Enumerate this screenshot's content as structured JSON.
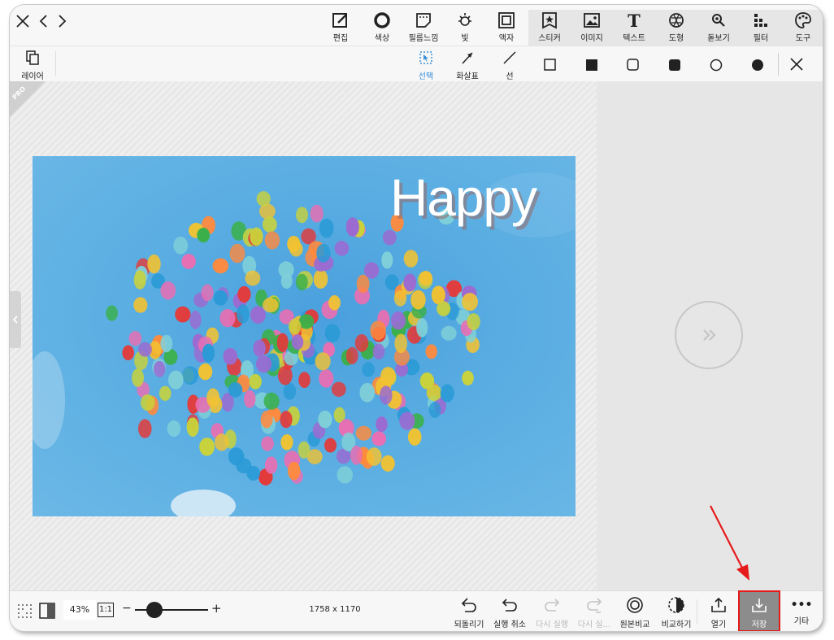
{
  "top_tools": [
    {
      "label": "편집",
      "icon": "edit-icon"
    },
    {
      "label": "색상",
      "icon": "color-circle-icon"
    },
    {
      "label": "필름느낌",
      "icon": "film-icon"
    },
    {
      "label": "빛",
      "icon": "light-icon"
    },
    {
      "label": "액자",
      "icon": "frame-icon"
    },
    {
      "label": "스티커",
      "icon": "sticker-icon"
    },
    {
      "label": "이미지",
      "icon": "image-icon"
    },
    {
      "label": "텍스트",
      "icon": "text-icon"
    },
    {
      "label": "도형",
      "icon": "shape-icon"
    },
    {
      "label": "돋보기",
      "icon": "magnifier-icon"
    },
    {
      "label": "필터",
      "icon": "filter-icon"
    },
    {
      "label": "도구",
      "icon": "palette-icon"
    }
  ],
  "layer_label": "레이어",
  "draw_tools": [
    {
      "label": "선택",
      "icon": "select-icon"
    },
    {
      "label": "화살표",
      "icon": "arrow-icon"
    },
    {
      "label": "선",
      "icon": "line-icon"
    }
  ],
  "shape_tools": [
    "square-outline-icon",
    "square-filled-icon",
    "rounded-square-outline-icon",
    "rounded-square-filled-icon",
    "circle-outline-icon",
    "circle-filled-icon"
  ],
  "pro_badge": "PRO",
  "photo_text": "Happy",
  "zoom_percent": "43%",
  "zoom_ratio": "1:1",
  "zoom_level": 0.27,
  "image_size": "1758 x 1170",
  "bottom_tools": [
    {
      "label": "되돌리기",
      "icon": "revert-icon",
      "enabled": true
    },
    {
      "label": "실행 취소",
      "icon": "undo-icon",
      "enabled": true
    },
    {
      "label": "다시 실행",
      "icon": "redo-icon",
      "enabled": false
    },
    {
      "label": "다시 실...",
      "icon": "redo-all-icon",
      "enabled": false
    },
    {
      "label": "원본비교",
      "icon": "compare-original-icon",
      "enabled": true
    },
    {
      "label": "비교하기",
      "icon": "compare-icon",
      "enabled": true
    },
    {
      "label": "열기",
      "icon": "open-icon",
      "enabled": true
    },
    {
      "label": "저장",
      "icon": "save-icon",
      "enabled": true
    },
    {
      "label": "기타",
      "icon": "more-icon",
      "enabled": true
    }
  ],
  "colors": {
    "accent": "#3a8fd6",
    "highlight": "#e51b1b",
    "save_bg": "#8c8c8c"
  }
}
